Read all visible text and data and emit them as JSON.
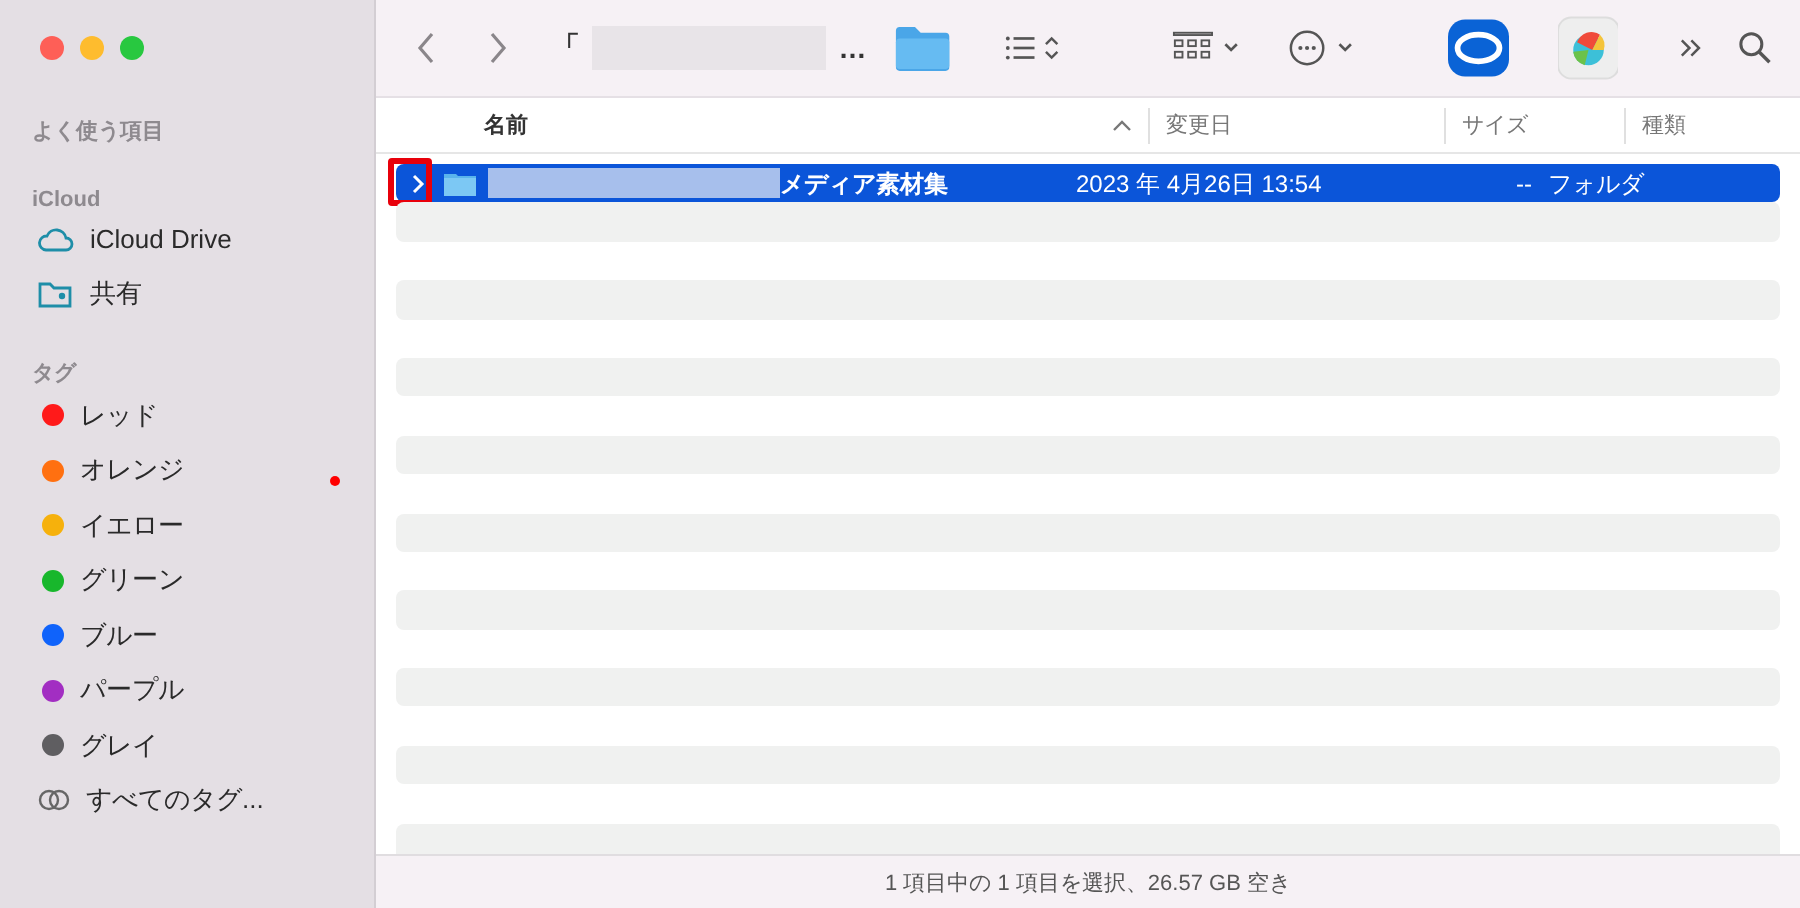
{
  "sidebar": {
    "sections": [
      {
        "heading": "よく使う項目"
      },
      {
        "heading": "iCloud",
        "items": [
          {
            "kind": "cloud",
            "label": "iCloud Drive"
          },
          {
            "kind": "shared",
            "label": "共有"
          }
        ]
      },
      {
        "heading": "タグ",
        "items": [
          {
            "kind": "tag",
            "label": "レッド",
            "color": "#ff1a1a"
          },
          {
            "kind": "tag",
            "label": "オレンジ",
            "color": "#ff7010"
          },
          {
            "kind": "tag",
            "label": "イエロー",
            "color": "#f6b10c"
          },
          {
            "kind": "tag",
            "label": "グリーン",
            "color": "#18b72c"
          },
          {
            "kind": "tag",
            "label": "ブルー",
            "color": "#0f63fb"
          },
          {
            "kind": "tag",
            "label": "パープル",
            "color": "#a22ec2"
          },
          {
            "kind": "tag",
            "label": "グレイ",
            "color": "#5f5e61"
          },
          {
            "kind": "all-tags",
            "label": "すべてのタグ..."
          }
        ]
      }
    ]
  },
  "toolbar": {
    "title_prefix": "「",
    "title_suffix": "…"
  },
  "table": {
    "columns": [
      {
        "label": "名前",
        "sorted": true
      },
      {
        "label": "変更日",
        "sorted": false
      },
      {
        "label": "サイズ",
        "sorted": false
      },
      {
        "label": "種類",
        "sorted": false
      }
    ],
    "rows": [
      {
        "name": "メディア素材集",
        "modified": "2023 年 4月26日 13:54",
        "size": "--",
        "kind": "フォルダ",
        "selected": true,
        "expanded": false
      }
    ]
  },
  "status_bar": "1 項目中の 1 項目を選択、26.57 GB 空き"
}
